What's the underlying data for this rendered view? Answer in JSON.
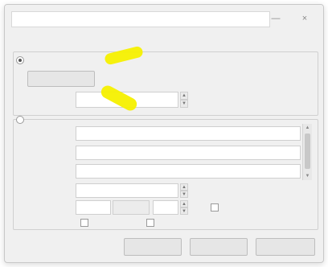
{
  "window": {
    "title": "",
    "close_glyph": "×",
    "minimize_glyph": "—"
  },
  "section_header": "",
  "group_a": {
    "radio_label": "",
    "selected": true,
    "button_label": "",
    "scale_label": "",
    "scale_value": "",
    "scale_unit_label": ""
  },
  "group_b": {
    "radio_label": "",
    "selected": false,
    "rows": [
      {
        "label": "",
        "value": ""
      },
      {
        "label": "",
        "value": ""
      },
      {
        "label": "",
        "value": ""
      },
      {
        "label": "",
        "value": ""
      }
    ],
    "color_label": "",
    "color_checkbox_label": "",
    "options_label": "",
    "option_1": "",
    "option_2": ""
  },
  "footer": {
    "button_1": "",
    "button_2": "",
    "button_3": ""
  },
  "highlight_color": "#f5f000",
  "icons": {
    "spin_up": "▲",
    "spin_down": "▼",
    "scroll_up": "▲",
    "scroll_down": "▼"
  }
}
